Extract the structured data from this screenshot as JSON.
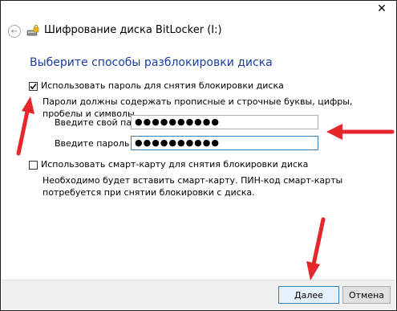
{
  "window": {
    "title": "Шифрование диска BitLocker (I:)",
    "close_glyph": "✕",
    "back_glyph": "←"
  },
  "heading": "Выберите способы разблокировки диска",
  "password_option": {
    "checked": true,
    "label": "Использовать пароль для снятия блокировки диска",
    "hint": "Пароли должны содержать прописные и строчные буквы, цифры, пробелы и символы.",
    "enter_label": "Введите свой пароль",
    "enter_value": "●●●●●●●●●●",
    "repeat_label": "Введите пароль еще раз",
    "repeat_value": "●●●●●●●●●●"
  },
  "smartcard_option": {
    "checked": false,
    "label": "Использовать смарт-карту для снятия блокировки диска",
    "hint": "Необходимо будет вставить смарт-карту. ПИН-код смарт-карты потребуется при снятии блокировки с диска."
  },
  "buttons": {
    "next": "Далее",
    "cancel": "Отмена"
  },
  "colors": {
    "heading": "#1a3e9c",
    "arrow": "#e5262a",
    "focus_border": "#3c7fb1"
  }
}
